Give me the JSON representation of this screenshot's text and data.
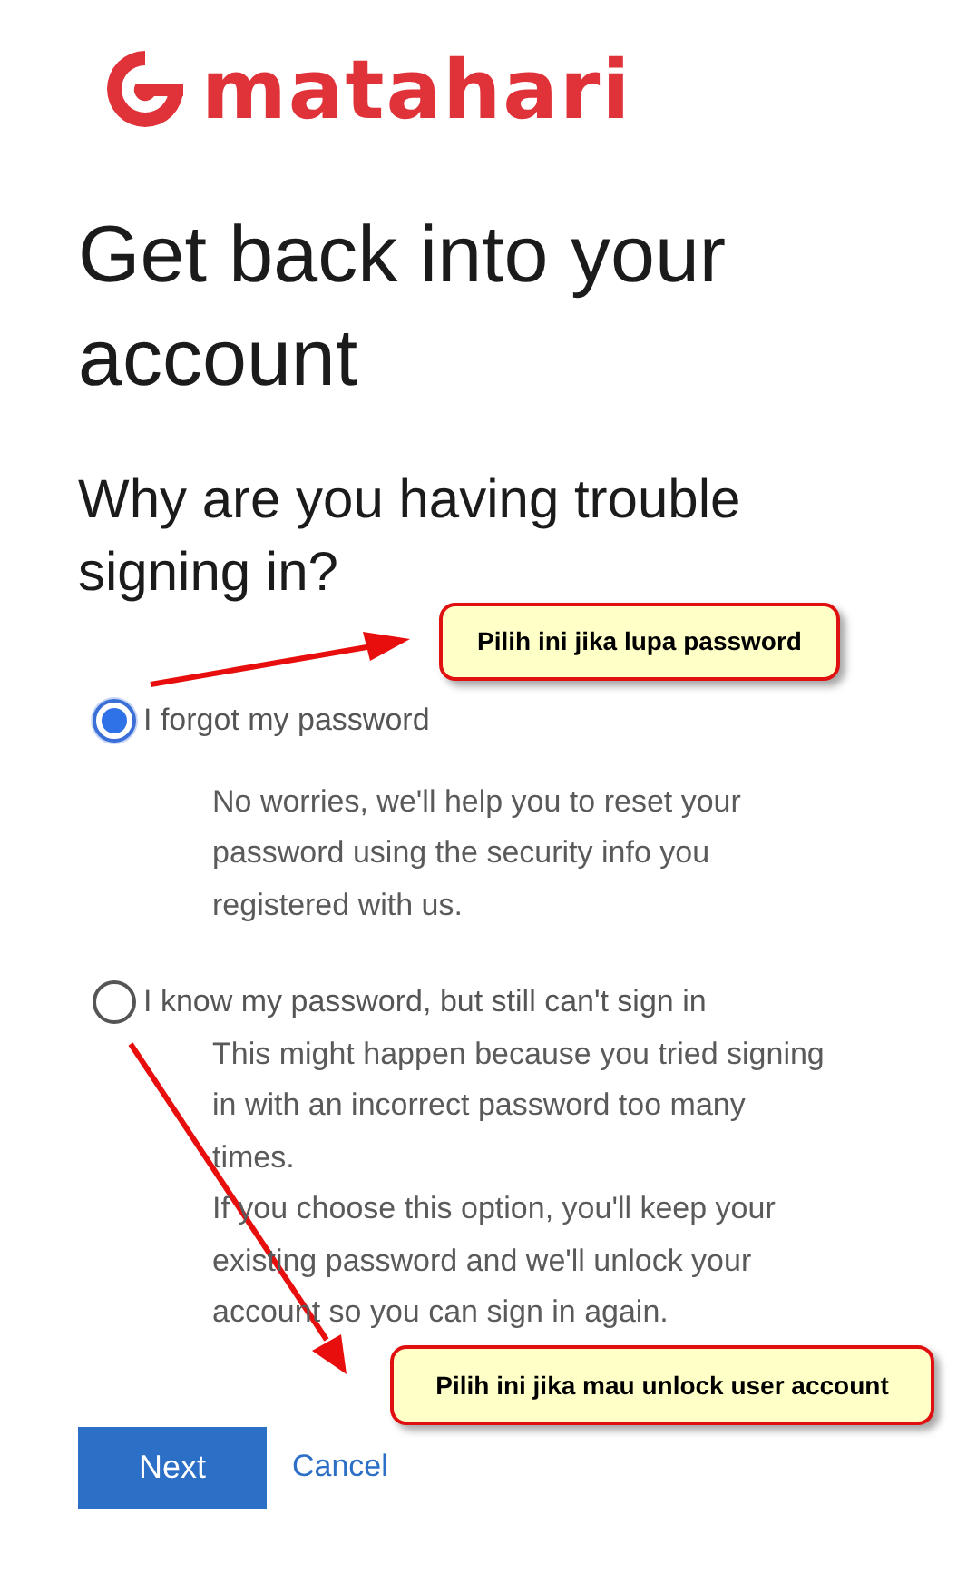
{
  "logo": {
    "text": "matahari"
  },
  "heading": "Get back into your account",
  "subheading": "Why are you having trouble signing in?",
  "options": [
    {
      "label": "I forgot my password",
      "selected": true,
      "description": [
        "No worries, we'll help you to reset your password using the security info you registered with us."
      ]
    },
    {
      "label": "I know my password, but still can't sign in",
      "selected": false,
      "description": [
        "This might happen because you tried signing in with an incorrect password too many times.",
        "If you choose this option, you'll keep your existing password and we'll unlock your account so you can sign in again."
      ]
    }
  ],
  "buttons": {
    "primary": "Next",
    "secondary": "Cancel"
  },
  "annotations": [
    {
      "text": "Pilih ini jika lupa password"
    },
    {
      "text": "Pilih ini jika mau unlock user account"
    }
  ]
}
